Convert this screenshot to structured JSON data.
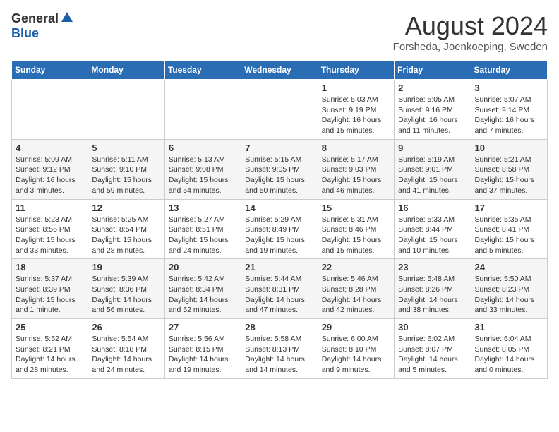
{
  "header": {
    "logo_general": "General",
    "logo_blue": "Blue",
    "month_title": "August 2024",
    "subtitle": "Forsheda, Joenkoeping, Sweden"
  },
  "days_of_week": [
    "Sunday",
    "Monday",
    "Tuesday",
    "Wednesday",
    "Thursday",
    "Friday",
    "Saturday"
  ],
  "weeks": [
    [
      {
        "day": "",
        "sunrise": "",
        "sunset": "",
        "daylight": ""
      },
      {
        "day": "",
        "sunrise": "",
        "sunset": "",
        "daylight": ""
      },
      {
        "day": "",
        "sunrise": "",
        "sunset": "",
        "daylight": ""
      },
      {
        "day": "",
        "sunrise": "",
        "sunset": "",
        "daylight": ""
      },
      {
        "day": "1",
        "sunrise": "Sunrise: 5:03 AM",
        "sunset": "Sunset: 9:19 PM",
        "daylight": "Daylight: 16 hours and 15 minutes."
      },
      {
        "day": "2",
        "sunrise": "Sunrise: 5:05 AM",
        "sunset": "Sunset: 9:16 PM",
        "daylight": "Daylight: 16 hours and 11 minutes."
      },
      {
        "day": "3",
        "sunrise": "Sunrise: 5:07 AM",
        "sunset": "Sunset: 9:14 PM",
        "daylight": "Daylight: 16 hours and 7 minutes."
      }
    ],
    [
      {
        "day": "4",
        "sunrise": "Sunrise: 5:09 AM",
        "sunset": "Sunset: 9:12 PM",
        "daylight": "Daylight: 16 hours and 3 minutes."
      },
      {
        "day": "5",
        "sunrise": "Sunrise: 5:11 AM",
        "sunset": "Sunset: 9:10 PM",
        "daylight": "Daylight: 15 hours and 59 minutes."
      },
      {
        "day": "6",
        "sunrise": "Sunrise: 5:13 AM",
        "sunset": "Sunset: 9:08 PM",
        "daylight": "Daylight: 15 hours and 54 minutes."
      },
      {
        "day": "7",
        "sunrise": "Sunrise: 5:15 AM",
        "sunset": "Sunset: 9:05 PM",
        "daylight": "Daylight: 15 hours and 50 minutes."
      },
      {
        "day": "8",
        "sunrise": "Sunrise: 5:17 AM",
        "sunset": "Sunset: 9:03 PM",
        "daylight": "Daylight: 15 hours and 46 minutes."
      },
      {
        "day": "9",
        "sunrise": "Sunrise: 5:19 AM",
        "sunset": "Sunset: 9:01 PM",
        "daylight": "Daylight: 15 hours and 41 minutes."
      },
      {
        "day": "10",
        "sunrise": "Sunrise: 5:21 AM",
        "sunset": "Sunset: 8:58 PM",
        "daylight": "Daylight: 15 hours and 37 minutes."
      }
    ],
    [
      {
        "day": "11",
        "sunrise": "Sunrise: 5:23 AM",
        "sunset": "Sunset: 8:56 PM",
        "daylight": "Daylight: 15 hours and 33 minutes."
      },
      {
        "day": "12",
        "sunrise": "Sunrise: 5:25 AM",
        "sunset": "Sunset: 8:54 PM",
        "daylight": "Daylight: 15 hours and 28 minutes."
      },
      {
        "day": "13",
        "sunrise": "Sunrise: 5:27 AM",
        "sunset": "Sunset: 8:51 PM",
        "daylight": "Daylight: 15 hours and 24 minutes."
      },
      {
        "day": "14",
        "sunrise": "Sunrise: 5:29 AM",
        "sunset": "Sunset: 8:49 PM",
        "daylight": "Daylight: 15 hours and 19 minutes."
      },
      {
        "day": "15",
        "sunrise": "Sunrise: 5:31 AM",
        "sunset": "Sunset: 8:46 PM",
        "daylight": "Daylight: 15 hours and 15 minutes."
      },
      {
        "day": "16",
        "sunrise": "Sunrise: 5:33 AM",
        "sunset": "Sunset: 8:44 PM",
        "daylight": "Daylight: 15 hours and 10 minutes."
      },
      {
        "day": "17",
        "sunrise": "Sunrise: 5:35 AM",
        "sunset": "Sunset: 8:41 PM",
        "daylight": "Daylight: 15 hours and 5 minutes."
      }
    ],
    [
      {
        "day": "18",
        "sunrise": "Sunrise: 5:37 AM",
        "sunset": "Sunset: 8:39 PM",
        "daylight": "Daylight: 15 hours and 1 minute."
      },
      {
        "day": "19",
        "sunrise": "Sunrise: 5:39 AM",
        "sunset": "Sunset: 8:36 PM",
        "daylight": "Daylight: 14 hours and 56 minutes."
      },
      {
        "day": "20",
        "sunrise": "Sunrise: 5:42 AM",
        "sunset": "Sunset: 8:34 PM",
        "daylight": "Daylight: 14 hours and 52 minutes."
      },
      {
        "day": "21",
        "sunrise": "Sunrise: 5:44 AM",
        "sunset": "Sunset: 8:31 PM",
        "daylight": "Daylight: 14 hours and 47 minutes."
      },
      {
        "day": "22",
        "sunrise": "Sunrise: 5:46 AM",
        "sunset": "Sunset: 8:28 PM",
        "daylight": "Daylight: 14 hours and 42 minutes."
      },
      {
        "day": "23",
        "sunrise": "Sunrise: 5:48 AM",
        "sunset": "Sunset: 8:26 PM",
        "daylight": "Daylight: 14 hours and 38 minutes."
      },
      {
        "day": "24",
        "sunrise": "Sunrise: 5:50 AM",
        "sunset": "Sunset: 8:23 PM",
        "daylight": "Daylight: 14 hours and 33 minutes."
      }
    ],
    [
      {
        "day": "25",
        "sunrise": "Sunrise: 5:52 AM",
        "sunset": "Sunset: 8:21 PM",
        "daylight": "Daylight: 14 hours and 28 minutes."
      },
      {
        "day": "26",
        "sunrise": "Sunrise: 5:54 AM",
        "sunset": "Sunset: 8:18 PM",
        "daylight": "Daylight: 14 hours and 24 minutes."
      },
      {
        "day": "27",
        "sunrise": "Sunrise: 5:56 AM",
        "sunset": "Sunset: 8:15 PM",
        "daylight": "Daylight: 14 hours and 19 minutes."
      },
      {
        "day": "28",
        "sunrise": "Sunrise: 5:58 AM",
        "sunset": "Sunset: 8:13 PM",
        "daylight": "Daylight: 14 hours and 14 minutes."
      },
      {
        "day": "29",
        "sunrise": "Sunrise: 6:00 AM",
        "sunset": "Sunset: 8:10 PM",
        "daylight": "Daylight: 14 hours and 9 minutes."
      },
      {
        "day": "30",
        "sunrise": "Sunrise: 6:02 AM",
        "sunset": "Sunset: 8:07 PM",
        "daylight": "Daylight: 14 hours and 5 minutes."
      },
      {
        "day": "31",
        "sunrise": "Sunrise: 6:04 AM",
        "sunset": "Sunset: 8:05 PM",
        "daylight": "Daylight: 14 hours and 0 minutes."
      }
    ]
  ]
}
